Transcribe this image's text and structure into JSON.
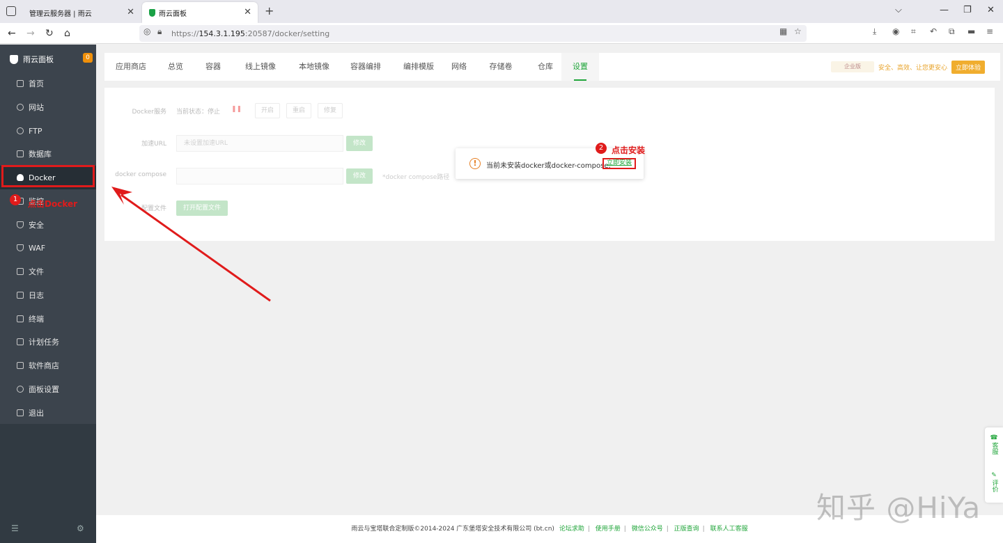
{
  "browser": {
    "tabs": [
      {
        "label": "管理云服务器 | 雨云"
      },
      {
        "label": "雨云面板"
      }
    ],
    "url_prefix": "https://",
    "url_host": "154.3.1.195",
    "url_rest": ":20587/docker/setting"
  },
  "sidebar": {
    "brand": "雨云面板",
    "badge": "0",
    "items": [
      {
        "label": "首页",
        "icon": "home-icon"
      },
      {
        "label": "网站",
        "icon": "globe-icon"
      },
      {
        "label": "FTP",
        "icon": "ftp-icon"
      },
      {
        "label": "数据库",
        "icon": "database-icon"
      },
      {
        "label": "Docker",
        "icon": "docker-icon"
      },
      {
        "label": "监控",
        "icon": "monitor-icon"
      },
      {
        "label": "安全",
        "icon": "shield-icon"
      },
      {
        "label": "WAF",
        "icon": "waf-icon"
      },
      {
        "label": "文件",
        "icon": "folder-icon"
      },
      {
        "label": "日志",
        "icon": "log-icon"
      },
      {
        "label": "终端",
        "icon": "terminal-icon"
      },
      {
        "label": "计划任务",
        "icon": "cron-icon"
      },
      {
        "label": "软件商店",
        "icon": "store-icon"
      },
      {
        "label": "面板设置",
        "icon": "settings-icon"
      },
      {
        "label": "退出",
        "icon": "logout-icon"
      }
    ]
  },
  "subtabs": [
    "应用商店",
    "总览",
    "容器",
    "线上镜像",
    "本地镜像",
    "容器编排",
    "编排模版",
    "网络",
    "存储卷",
    "仓库",
    "设置"
  ],
  "promo": {
    "edition": "企业版",
    "text": "安全、高效、让您更安心",
    "button": "立即体验"
  },
  "settings": {
    "service_label": "Docker服务",
    "status_text": "当前状态：停止",
    "start_btn": "开启",
    "restart_btn": "重启",
    "repair_btn": "修复",
    "mirror_label": "加速URL",
    "mirror_placeholder": "未设置加速URL",
    "modify_btn": "修改",
    "compose_label": "docker compose",
    "compose_hint": "*docker compose路径",
    "config_label": "配置文件",
    "open_config_btn": "打开配置文件"
  },
  "popup": {
    "message": "当前未安装docker或docker-compose,",
    "install_link": "立即安装"
  },
  "annotations": {
    "step1_num": "1",
    "step1_text": "点击Docker",
    "step2_num": "2",
    "step2_text": "点击安装"
  },
  "footer": {
    "copyright": "雨云与宝塔联合定制版©2014-2024 广东堡塔安全技术有限公司 (bt.cn)",
    "links": [
      "论坛求助",
      "使用手册",
      "微信公众号",
      "正版查询",
      "联系人工客服"
    ]
  },
  "float": {
    "service": "客服",
    "review": "评价"
  },
  "watermark": "知乎 @HiYa",
  "colors": {
    "accent": "#20a53a",
    "annotation": "#e01b1b",
    "sidebar": "#3c444d"
  }
}
